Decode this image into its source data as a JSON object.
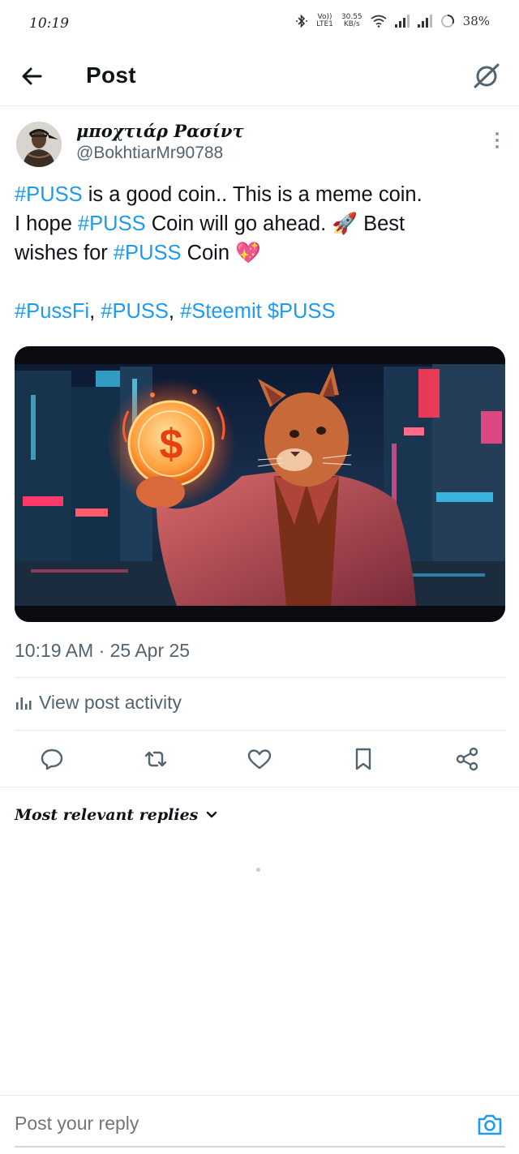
{
  "status_bar": {
    "time": "10:19",
    "network_label_top": "Vo))",
    "network_label_bottom": "LTE1",
    "speed_top": "30.55",
    "speed_bottom": "KB/s",
    "battery": "38%"
  },
  "header": {
    "title": "Post",
    "back_icon": "arrow-left-icon",
    "grok_icon": "grok-icon"
  },
  "post": {
    "author_name": "μποχτιάρ Ρασίντ",
    "author_handle": "@BokhtiarMr90788",
    "text": {
      "line1_tag": "#PUSS",
      "line1_rest": " is a good coin.. This is a meme coin.",
      "line2_start": "I hope ",
      "line2_tag": "#PUSS",
      "line2_rest": " Coin will go ahead. 🚀 Best",
      "line3_start": "wishes for ",
      "line3_tag": "#PUSS",
      "line3_rest": " Coin 💖",
      "tags_line": {
        "tag1": "#PussFi",
        "sep1": ", ",
        "tag2": "#PUSS",
        "sep2": ", ",
        "tag3": "#Steemit",
        "sep3": " ",
        "tag4": "$PUSS"
      }
    },
    "image_coin_symbol": "$",
    "timestamp": "10:19 AM · 25 Apr 25",
    "view_activity": "View post activity"
  },
  "actions": [
    "reply-icon",
    "repost-icon",
    "like-icon",
    "bookmark-icon",
    "share-icon"
  ],
  "replies": {
    "sort_label": "Most relevant replies"
  },
  "reply_box": {
    "placeholder": "Post your reply"
  },
  "colors": {
    "accent": "#1d9bf0",
    "text_primary": "#0f1419",
    "text_secondary": "#536471",
    "divider": "#e6e9eb"
  }
}
